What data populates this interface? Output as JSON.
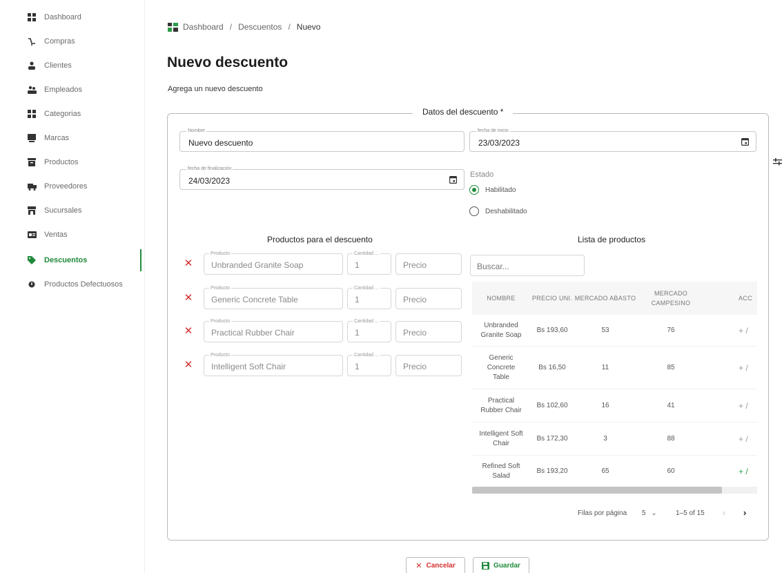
{
  "sidebar": {
    "items": [
      {
        "label": "Dashboard",
        "icon": "dashboard-icon"
      },
      {
        "label": "Compras",
        "icon": "shopping-icon"
      },
      {
        "label": "Clientes",
        "icon": "person-icon"
      },
      {
        "label": "Empleados",
        "icon": "people-icon"
      },
      {
        "label": "Categorias",
        "icon": "grid-icon"
      },
      {
        "label": "Marcas",
        "icon": "badge-icon"
      },
      {
        "label": "Productos",
        "icon": "archive-icon"
      },
      {
        "label": "Proveedores",
        "icon": "truck-icon"
      },
      {
        "label": "Sucursales",
        "icon": "store-icon"
      },
      {
        "label": "Ventas",
        "icon": "card-icon"
      },
      {
        "label": "Descuentos",
        "icon": "tag-icon",
        "active": true
      },
      {
        "label": "Productos Defectuosos",
        "icon": "warning-icon"
      }
    ],
    "accent_color": "#1f8a3a"
  },
  "breadcrumb": {
    "items": [
      "Dashboard",
      "Descuentos",
      "Nuevo"
    ],
    "separator": "/"
  },
  "page": {
    "title": "Nuevo descuento",
    "subtitle": "Agrega un nuevo descuento"
  },
  "form": {
    "legend": "Datos del descuento *",
    "nombre": {
      "label": "Nombre",
      "value": "Nuevo descuento"
    },
    "fecha_inicio": {
      "label": "fecha de inicio",
      "value": "23/03/2023"
    },
    "fecha_fin": {
      "label": "fecha de finalización",
      "value": "24/03/2023"
    },
    "estado": {
      "label": "Estado",
      "options": [
        "Habilitado",
        "Deshabilitado"
      ],
      "selected": "Habilitado"
    }
  },
  "productos_descuento": {
    "title": "Productos para el descuento",
    "field_labels": {
      "producto": "Producto",
      "cantidad": "Cantidad ..."
    },
    "rows": [
      {
        "producto": "Unbranded Granite Soap",
        "cantidad": "1",
        "precio": "Precio"
      },
      {
        "producto": "Generic Concrete Table",
        "cantidad": "1",
        "precio": "Precio"
      },
      {
        "producto": "Practical Rubber Chair",
        "cantidad": "1",
        "precio": "Precio"
      },
      {
        "producto": "Intelligent Soft Chair",
        "cantidad": "1",
        "precio": "Precio"
      }
    ]
  },
  "lista_productos": {
    "title": "Lista de productos",
    "search_placeholder": "Buscar...",
    "columns": [
      "NOMBRE",
      "PRECIO UNI.",
      "MERCADO ABASTO",
      "MERCADO CAMPESINO",
      "ACC"
    ],
    "rows": [
      {
        "nombre": "Unbranded Granite Soap",
        "precio": "Bs 193,60",
        "abasto": "53",
        "campesino": "76",
        "acc": "+ /"
      },
      {
        "nombre": "Generic Concrete Table",
        "precio": "Bs 16,50",
        "abasto": "11",
        "campesino": "85",
        "acc": "+ /"
      },
      {
        "nombre": "Practical Rubber Chair",
        "precio": "Bs 102,60",
        "abasto": "16",
        "campesino": "41",
        "acc": "+ /"
      },
      {
        "nombre": "Intelligent Soft Chair",
        "precio": "Bs 172,30",
        "abasto": "3",
        "campesino": "88",
        "acc": "+ /"
      },
      {
        "nombre": "Refined Soft Salad",
        "precio": "Bs 193,20",
        "abasto": "65",
        "campesino": "60",
        "acc": "+ /"
      }
    ],
    "pagination": {
      "rows_per_page_label": "Filas por página",
      "rows_per_page": "5",
      "range": "1–5 of 15"
    }
  },
  "actions": {
    "cancel": "Cancelar",
    "save": "Guardar"
  },
  "colors": {
    "danger": "#d32f2f",
    "success": "#1f8a3a"
  }
}
